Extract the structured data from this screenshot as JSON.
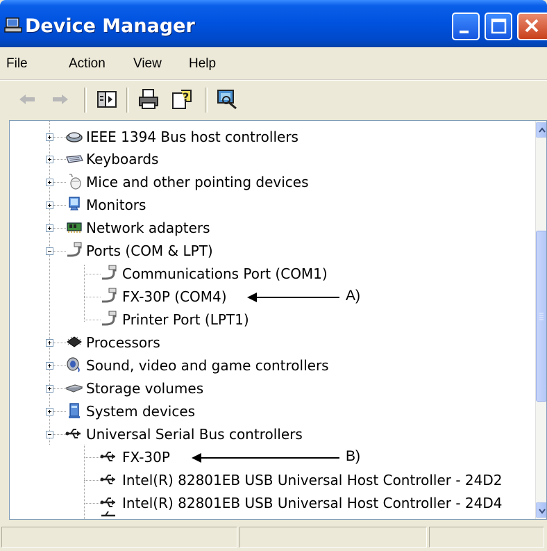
{
  "window": {
    "title": "Device Manager",
    "colors": {
      "titlebar": "#0052DE",
      "close_button": "#C9401B",
      "face": "#ECE9D8"
    }
  },
  "menubar": {
    "items": [
      "File",
      "Action",
      "View",
      "Help"
    ]
  },
  "toolbar": {
    "icons": [
      "back-arrow-icon",
      "forward-arrow-icon",
      "properties-pane-icon",
      "print-icon",
      "help-icon",
      "scan-hardware-icon"
    ]
  },
  "tree": {
    "items": [
      {
        "label": "IEEE 1394 Bus host controllers",
        "icon": "firewire-icon",
        "expanded": false
      },
      {
        "label": "Keyboards",
        "icon": "keyboard-icon",
        "expanded": false
      },
      {
        "label": "Mice and other pointing devices",
        "icon": "mouse-icon",
        "expanded": false
      },
      {
        "label": "Monitors",
        "icon": "monitor-icon",
        "expanded": false
      },
      {
        "label": "Network adapters",
        "icon": "network-adapter-icon",
        "expanded": false
      },
      {
        "label": "Ports (COM & LPT)",
        "icon": "port-icon",
        "expanded": true
      },
      {
        "label": "Communications Port (COM1)",
        "icon": "port-icon",
        "child": true
      },
      {
        "label": "FX-30P (COM4)",
        "icon": "port-icon",
        "child": true
      },
      {
        "label": "Printer Port (LPT1)",
        "icon": "port-icon",
        "child": true
      },
      {
        "label": "Processors",
        "icon": "processor-icon",
        "expanded": false
      },
      {
        "label": "Sound, video and game controllers",
        "icon": "sound-icon",
        "expanded": false
      },
      {
        "label": "Storage volumes",
        "icon": "storage-icon",
        "expanded": false
      },
      {
        "label": "System devices",
        "icon": "system-device-icon",
        "expanded": false
      },
      {
        "label": "Universal Serial Bus controllers",
        "icon": "usb-icon",
        "expanded": true
      },
      {
        "label": "FX-30P",
        "icon": "usb-icon",
        "child": true
      },
      {
        "label": "Intel(R) 82801EB USB Universal Host Controller - 24D2",
        "icon": "usb-icon",
        "child": true
      },
      {
        "label": "Intel(R) 82801EB USB Universal Host Controller - 24D4",
        "icon": "usb-icon",
        "child": true
      }
    ]
  },
  "annotations": {
    "a": "A)",
    "b": "B)"
  }
}
